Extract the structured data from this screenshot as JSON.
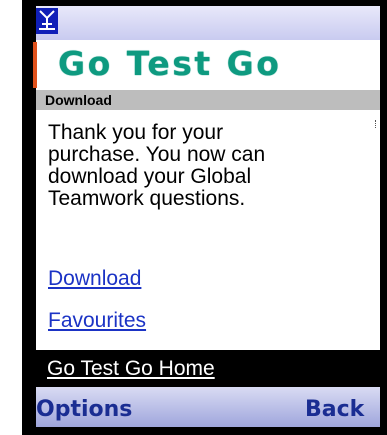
{
  "header": {
    "logo_text": "Go Test Go",
    "signal_icon": "antenna-signal-icon"
  },
  "screen": {
    "title": "Download",
    "message": "Thank you for your purchase. You now can download your Global Teamwork questions."
  },
  "links": {
    "download": "Download",
    "favourites": "Favourites",
    "home": "Go Test Go Home"
  },
  "softkeys": {
    "left": "Options",
    "right": "Back"
  },
  "colors": {
    "logo": "#0e9a80",
    "link": "#1b33c5",
    "softkey_text": "#1a2d92",
    "title_bar": "#bdbdbd"
  }
}
